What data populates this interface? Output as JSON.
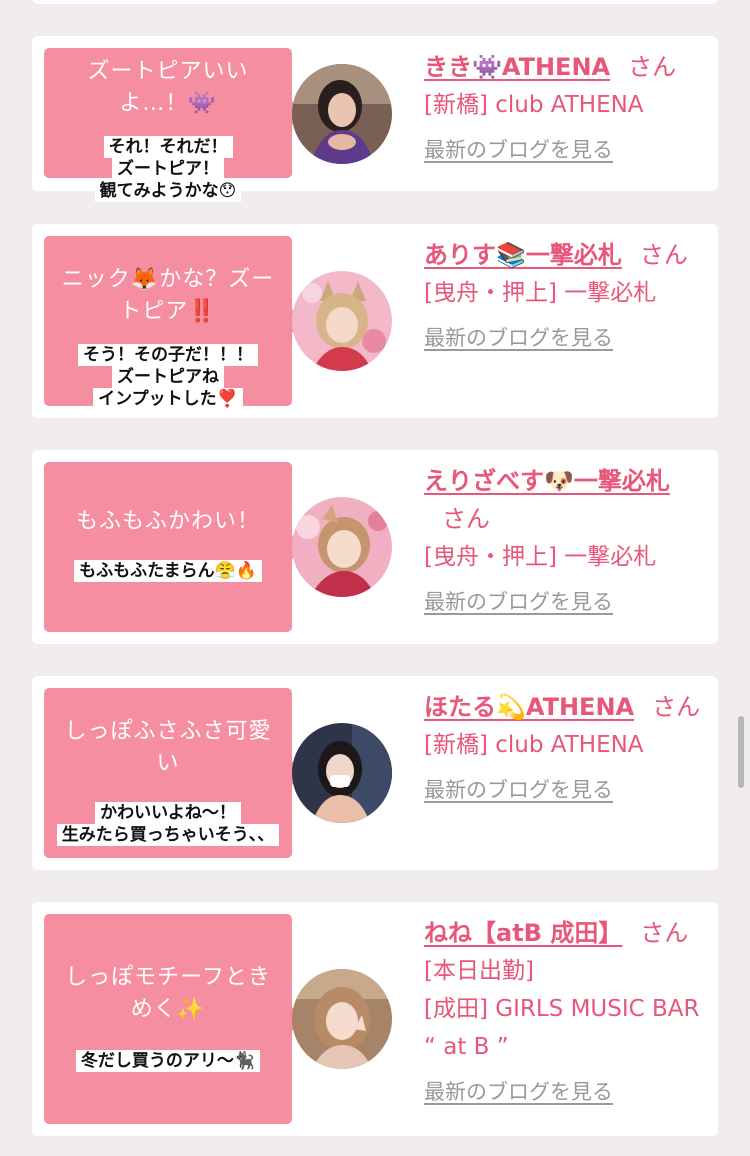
{
  "cards": [
    {
      "bubble": "ズートピアいいよ…！👾",
      "caption_lines": [
        "それ！それだ！",
        "ズートピア！",
        "観てみようかな😯"
      ],
      "name": "きき👾ATHENA",
      "honorific": "さん",
      "meta_lines": [
        "[新橋] club ATHENA"
      ],
      "blog_link": "最新のブログを見る"
    },
    {
      "bubble": "ニック🦊かな？ズートピア‼️",
      "caption_lines": [
        "そう！その子だ！！！",
        "ズートピアね",
        "インプットした❣️"
      ],
      "name": "ありす📚一撃必札",
      "honorific": "さん",
      "meta_lines": [
        "[曳舟・押上] 一撃必札"
      ],
      "blog_link": "最新のブログを見る"
    },
    {
      "bubble": "もふもふかわい！",
      "caption_lines": [
        "もふもふたまらん😤🔥"
      ],
      "name": "えりざべす🐶一撃必札",
      "honorific": "さん",
      "meta_lines": [
        "[曳舟・押上] 一撃必札"
      ],
      "blog_link": "最新のブログを見る"
    },
    {
      "bubble": "しっぽふさふさ可愛い",
      "caption_lines": [
        "かわいいよね〜！",
        "生みたら買っちゃいそう、、"
      ],
      "name": "ほたる💫ATHENA",
      "honorific": "さん",
      "meta_lines": [
        "[新橋] club ATHENA"
      ],
      "blog_link": "最新のブログを見る"
    },
    {
      "bubble": "しっぽモチーフときめく✨",
      "caption_lines": [
        "冬だし買うのアリ〜🐈‍⬛"
      ],
      "name": "ねね【atB 成田】",
      "honorific": "さん",
      "meta_lines": [
        "[本日出勤]",
        "[成田] GIRLS MUSIC BAR “ at B ”"
      ],
      "blog_link": "最新のブログを見る"
    }
  ],
  "colors": {
    "page_bg": "#f1eded",
    "card_bg": "#ffffff",
    "bubble_bg": "#f58ea0",
    "accent": "#e8567a",
    "link_gray": "#999999"
  }
}
